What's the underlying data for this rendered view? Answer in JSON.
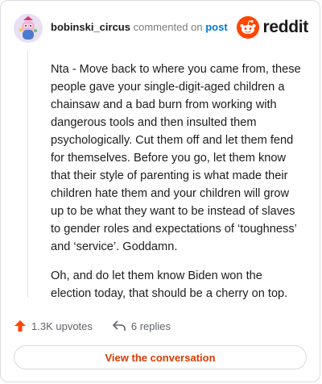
{
  "header": {
    "username": "bobinski_circus",
    "action_text": "commented on",
    "post_link": "post",
    "brand_word": "reddit"
  },
  "comment": {
    "paragraphs": [
      "Nta - Move back to where you came from, these people gave your single-digit-aged children a chainsaw and a bad burn from working with dangerous tools and then insulted them psychologically. Cut them off and let them fend for themselves. Before you go, let them know that their style of parenting is what made their children hate them and your children will grow up to be what they want to be instead of slaves to gender roles and expectations of ‘toughness’ and ‘service’. Goddamn.",
      "Oh, and do let them know Biden won the election today, that should be a cherry on top."
    ]
  },
  "actions": {
    "upvotes": "1.3K upvotes",
    "replies": "6 replies"
  },
  "cta": {
    "label": "View the conversation"
  },
  "icons": {
    "avatar": "snoo-avatar-icon",
    "brand": "reddit-snoo-icon",
    "upvote": "upvote-arrow-icon",
    "reply": "reply-arrow-icon"
  },
  "colors": {
    "brand_orange": "#ff4500",
    "link_blue": "#0079d3",
    "cta_text": "#d93a00",
    "upvote_orange": "#ff4500"
  }
}
